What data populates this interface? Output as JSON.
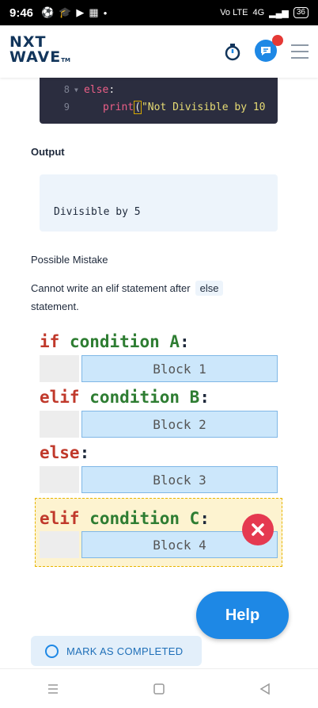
{
  "status_bar": {
    "time": "9:46",
    "network_label": "Vo LTE",
    "signal_label": "4G",
    "battery": "36",
    "icons": [
      "soccer-icon",
      "graduation-cap-icon",
      "youtube-icon",
      "news-icon",
      "dot-icon"
    ]
  },
  "header": {
    "logo_line1": "NXT",
    "logo_line2": "WAVE",
    "logo_tm": "TM",
    "icons": [
      "timer-icon",
      "chat-icon",
      "menu-icon"
    ],
    "colors": {
      "brand": "#12355b",
      "accent": "#1e88e5",
      "notification": "#e53935"
    }
  },
  "code": {
    "lines": [
      {
        "num": "8",
        "keyword": "else",
        "rest": ":"
      },
      {
        "num": "9",
        "fn": "print",
        "open_paren": "(",
        "string": "\"Not Divisible by 10"
      }
    ]
  },
  "output": {
    "title": "Output",
    "text": "Divisible by 5"
  },
  "mistake": {
    "title": "Possible Mistake",
    "text_before": "Cannot write an elif statement after",
    "code": "else",
    "text_after": "statement."
  },
  "diagram": {
    "lines": [
      {
        "keyword": "if",
        "condition": "condition A",
        "colon": ":",
        "block": "Block 1"
      },
      {
        "keyword": "elif",
        "condition": "condition B",
        "colon": ":",
        "block": "Block 2"
      },
      {
        "keyword": "else",
        "condition": "",
        "colon": ":",
        "block": "Block 3"
      },
      {
        "keyword": "elif",
        "condition": "condition C",
        "colon": ":",
        "block": "Block 4"
      }
    ],
    "error_icon": "close-circle-icon",
    "colors": {
      "keyword": "#c0392b",
      "condition": "#2e7d32",
      "block": "#cce7fb",
      "error": "#e53950",
      "error_zone": "#fdf3d0"
    }
  },
  "help": {
    "label": "Help"
  },
  "mark": {
    "label": "MARK AS COMPLETED",
    "icon": "circle-outline-icon"
  },
  "nav": {
    "icons": [
      "recent-apps-icon",
      "home-icon",
      "back-icon"
    ]
  }
}
